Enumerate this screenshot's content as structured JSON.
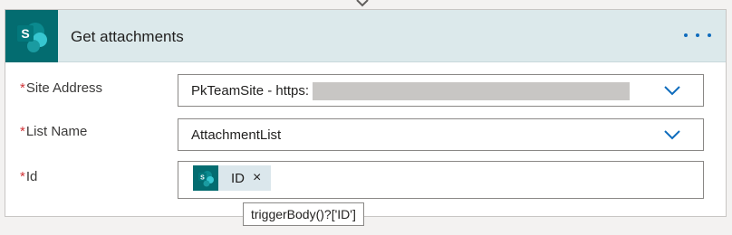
{
  "action": {
    "title": "Get attachments",
    "menu_icon": "more-horizontal-icon",
    "connector_icon": "sharepoint-icon"
  },
  "fields": {
    "site_address": {
      "required_mark": "*",
      "label": "Site Address",
      "value": "PkTeamSite - https:",
      "value_redacted": true
    },
    "list_name": {
      "required_mark": "*",
      "label": "List Name",
      "value": "AttachmentList"
    },
    "id": {
      "required_mark": "*",
      "label": "Id",
      "token": {
        "label": "ID",
        "remove_glyph": "×",
        "icon": "sharepoint-icon"
      }
    }
  },
  "tooltip": {
    "text": "triggerBody()?['ID']"
  },
  "colors": {
    "sharepoint_tile": "#036c70",
    "header_bg": "#dce9eb",
    "accent": "#0f6cbd",
    "required": "#d13438"
  }
}
